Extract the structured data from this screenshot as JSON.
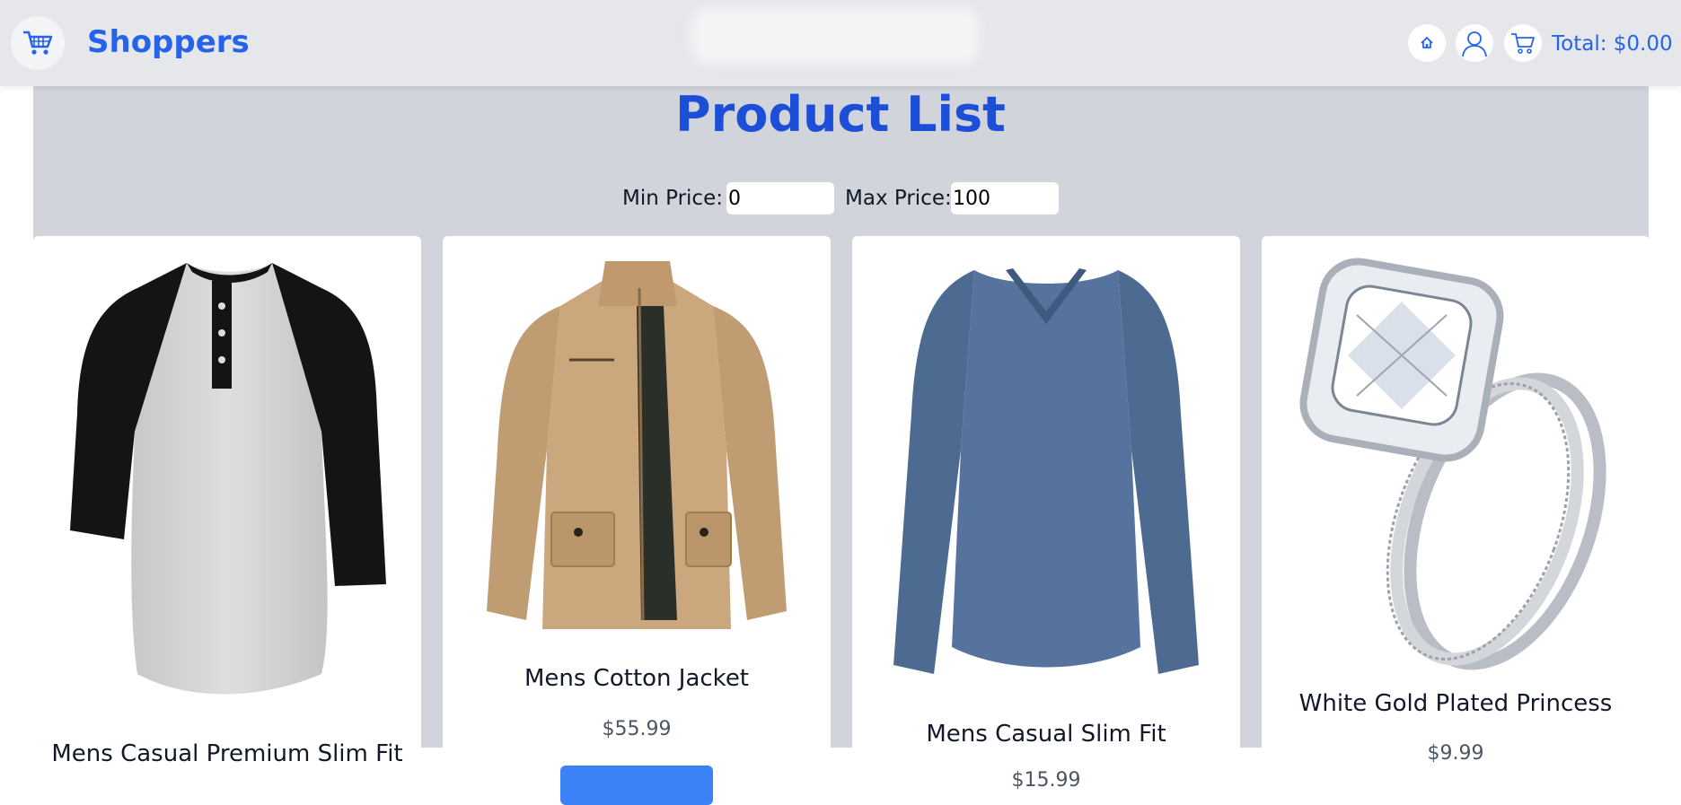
{
  "header": {
    "brand": "Shoppers",
    "total_label": "Total: $0.00"
  },
  "main": {
    "title": "Product List",
    "filters": {
      "min_label": "Min Price:",
      "min_value": "0",
      "max_label": "Max Price:",
      "max_value": "100"
    },
    "products": [
      {
        "title": "Mens Casual Premium Slim Fit",
        "price": "",
        "image": "raglan-tshirt-image"
      },
      {
        "title": "Mens Cotton Jacket",
        "price": "$55.99",
        "image": "cotton-jacket-image"
      },
      {
        "title": "Mens Casual Slim Fit",
        "price": "$15.99",
        "image": "slim-fit-shirt-image"
      },
      {
        "title": "White Gold Plated Princess",
        "price": "$9.99",
        "image": "ring-image"
      }
    ]
  },
  "colors": {
    "accent": "#2563eb",
    "title": "#1d4ed8",
    "nav_bg": "#e5e7eb",
    "main_bg": "#d1d5db",
    "button": "#3b82f6"
  }
}
